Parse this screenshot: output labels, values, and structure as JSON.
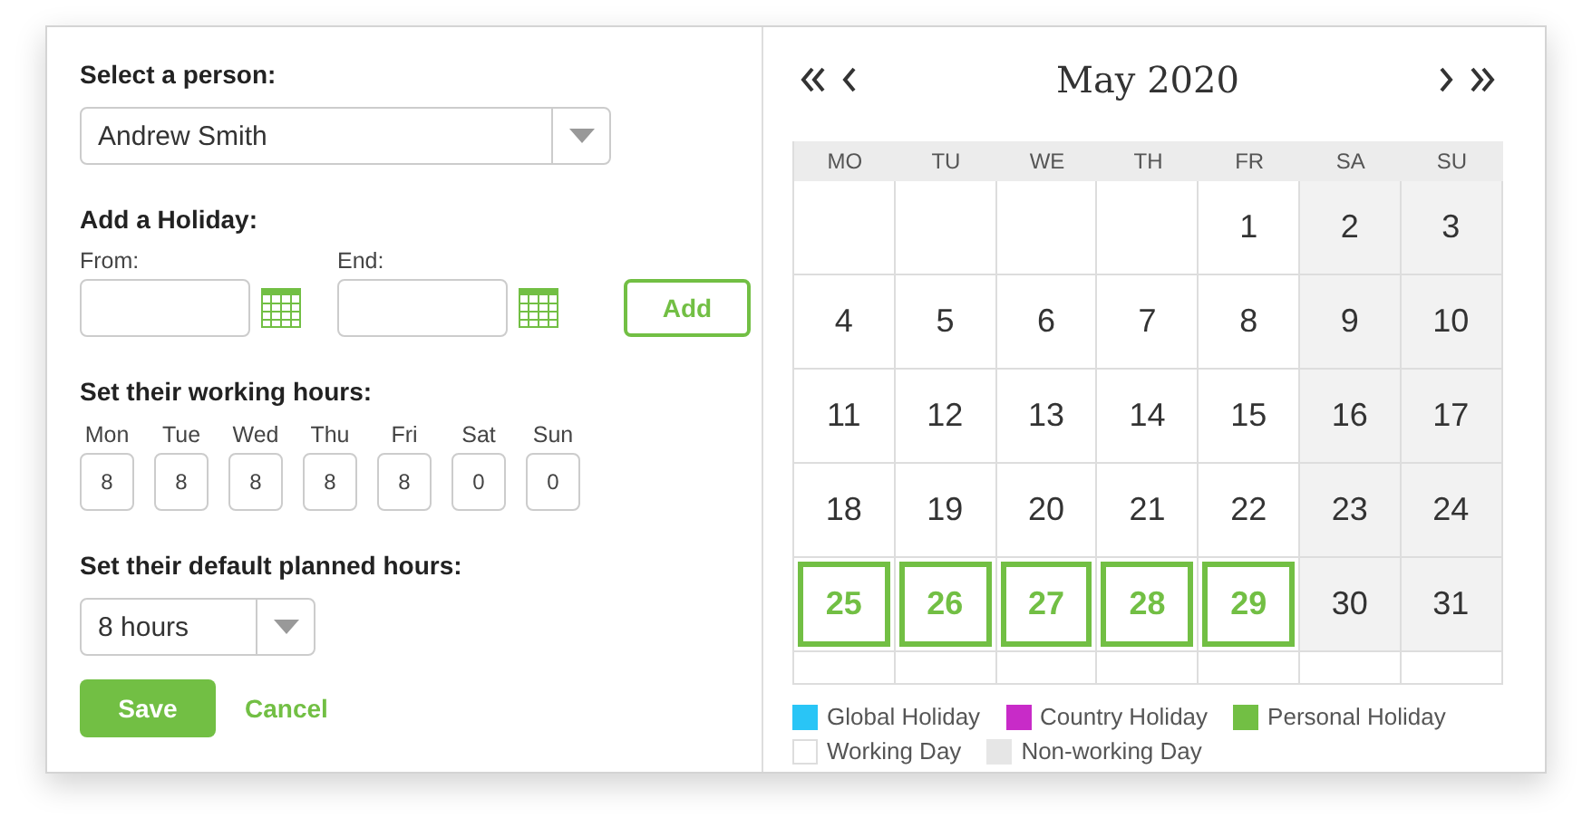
{
  "person": {
    "label": "Select a person:",
    "value": "Andrew Smith"
  },
  "holiday": {
    "title": "Add a Holiday:",
    "from_label": "From:",
    "end_label": "End:",
    "add_button": "Add"
  },
  "working_hours": {
    "title": "Set their working hours:",
    "days": [
      {
        "label": "Mon",
        "value": "8"
      },
      {
        "label": "Tue",
        "value": "8"
      },
      {
        "label": "Wed",
        "value": "8"
      },
      {
        "label": "Thu",
        "value": "8"
      },
      {
        "label": "Fri",
        "value": "8"
      },
      {
        "label": "Sat",
        "value": "0"
      },
      {
        "label": "Sun",
        "value": "0"
      }
    ]
  },
  "planned_hours": {
    "title": "Set their default planned hours:",
    "value": "8 hours"
  },
  "actions": {
    "save": "Save",
    "cancel": "Cancel"
  },
  "calendar": {
    "title": "May 2020",
    "weekdays": [
      "MO",
      "TU",
      "WE",
      "TH",
      "FR",
      "SA",
      "SU"
    ],
    "weeks": [
      [
        {
          "kind": "blank"
        },
        {
          "kind": "blank"
        },
        {
          "kind": "blank"
        },
        {
          "kind": "blank"
        },
        {
          "day": "1",
          "kind": "working"
        },
        {
          "day": "2",
          "kind": "nonworking"
        },
        {
          "day": "3",
          "kind": "nonworking"
        }
      ],
      [
        {
          "day": "4",
          "kind": "working"
        },
        {
          "day": "5",
          "kind": "working"
        },
        {
          "day": "6",
          "kind": "working"
        },
        {
          "day": "7",
          "kind": "working"
        },
        {
          "day": "8",
          "kind": "working"
        },
        {
          "day": "9",
          "kind": "nonworking"
        },
        {
          "day": "10",
          "kind": "nonworking"
        }
      ],
      [
        {
          "day": "11",
          "kind": "working"
        },
        {
          "day": "12",
          "kind": "working"
        },
        {
          "day": "13",
          "kind": "working"
        },
        {
          "day": "14",
          "kind": "working"
        },
        {
          "day": "15",
          "kind": "working"
        },
        {
          "day": "16",
          "kind": "nonworking"
        },
        {
          "day": "17",
          "kind": "nonworking"
        }
      ],
      [
        {
          "day": "18",
          "kind": "working"
        },
        {
          "day": "19",
          "kind": "working"
        },
        {
          "day": "20",
          "kind": "working"
        },
        {
          "day": "21",
          "kind": "working"
        },
        {
          "day": "22",
          "kind": "working"
        },
        {
          "day": "23",
          "kind": "nonworking"
        },
        {
          "day": "24",
          "kind": "nonworking"
        }
      ],
      [
        {
          "day": "25",
          "kind": "personal"
        },
        {
          "day": "26",
          "kind": "personal"
        },
        {
          "day": "27",
          "kind": "personal"
        },
        {
          "day": "28",
          "kind": "personal"
        },
        {
          "day": "29",
          "kind": "personal"
        },
        {
          "day": "30",
          "kind": "nonworking"
        },
        {
          "day": "31",
          "kind": "nonworking"
        }
      ],
      [
        {
          "kind": "blank"
        },
        {
          "kind": "blank"
        },
        {
          "kind": "blank"
        },
        {
          "kind": "blank"
        },
        {
          "kind": "blank"
        },
        {
          "kind": "blank"
        },
        {
          "kind": "blank"
        }
      ]
    ]
  },
  "legend": [
    {
      "label": "Global Holiday",
      "color": "#29c5f6"
    },
    {
      "label": "Country Holiday",
      "color": "#c82bc8"
    },
    {
      "label": "Personal Holiday",
      "color": "#72bf44"
    },
    {
      "label": "Working Day",
      "color": "#ffffff"
    },
    {
      "label": "Non-working Day",
      "color": "#e6e6e6"
    }
  ]
}
